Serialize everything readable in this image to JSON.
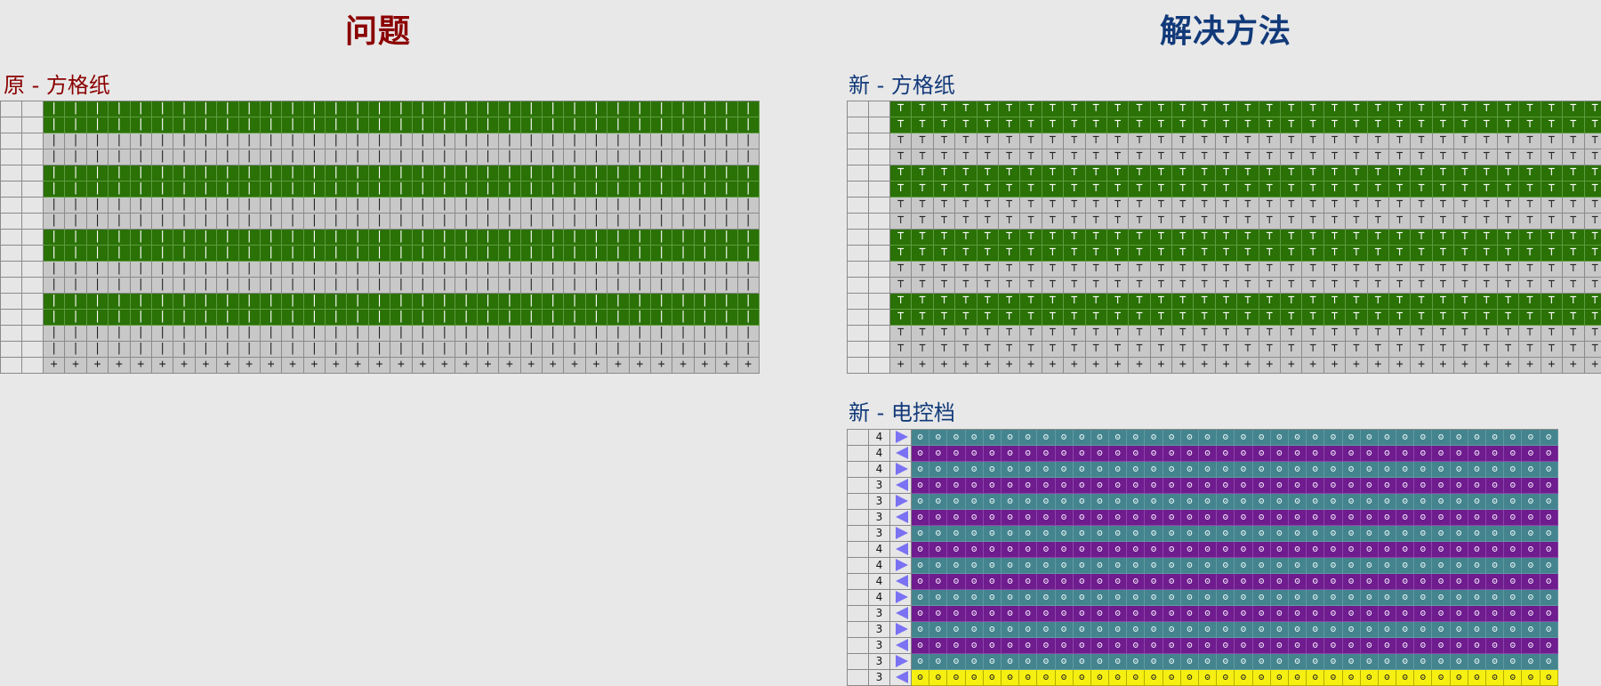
{
  "headings": {
    "problem": "问题",
    "solution": "解决方法"
  },
  "panels": {
    "original_grid": {
      "label": "原 - 方格纸"
    },
    "new_grid": {
      "label": "新 - 方格纸"
    },
    "new_control": {
      "label": "新 - 电控档"
    }
  },
  "symbols": {
    "bar": "|",
    "tee": "⊤",
    "plus": "+",
    "loop": "ʘ"
  },
  "colors": {
    "green": "#2a7106",
    "gray": "#c8c8c8",
    "teal": "#44848e",
    "purple": "#6e1c8e",
    "yellow": "#f6ef12",
    "arrow": "#7b72f3"
  },
  "original_rows": [
    "green",
    "green",
    "gray",
    "gray",
    "green",
    "green",
    "gray",
    "gray",
    "green",
    "green",
    "gray",
    "gray",
    "green",
    "green",
    "gray",
    "gray",
    "plus"
  ],
  "new_rows": [
    "green",
    "green",
    "gray",
    "gray",
    "green",
    "green",
    "gray",
    "gray",
    "green",
    "green",
    "gray",
    "gray",
    "green",
    "green",
    "gray",
    "gray",
    "plus"
  ],
  "control_rows": [
    {
      "num": "4",
      "dir": "right",
      "color": "teal"
    },
    {
      "num": "4",
      "dir": "left",
      "color": "purple"
    },
    {
      "num": "4",
      "dir": "right",
      "color": "teal"
    },
    {
      "num": "3",
      "dir": "left",
      "color": "purple"
    },
    {
      "num": "3",
      "dir": "right",
      "color": "teal"
    },
    {
      "num": "3",
      "dir": "left",
      "color": "purple"
    },
    {
      "num": "3",
      "dir": "right",
      "color": "teal"
    },
    {
      "num": "4",
      "dir": "left",
      "color": "purple"
    },
    {
      "num": "4",
      "dir": "right",
      "color": "teal"
    },
    {
      "num": "4",
      "dir": "left",
      "color": "purple"
    },
    {
      "num": "4",
      "dir": "right",
      "color": "teal"
    },
    {
      "num": "3",
      "dir": "left",
      "color": "purple"
    },
    {
      "num": "3",
      "dir": "right",
      "color": "teal"
    },
    {
      "num": "3",
      "dir": "left",
      "color": "purple"
    },
    {
      "num": "3",
      "dir": "right",
      "color": "teal"
    },
    {
      "num": "3",
      "dir": "left",
      "color": "yellow"
    }
  ]
}
